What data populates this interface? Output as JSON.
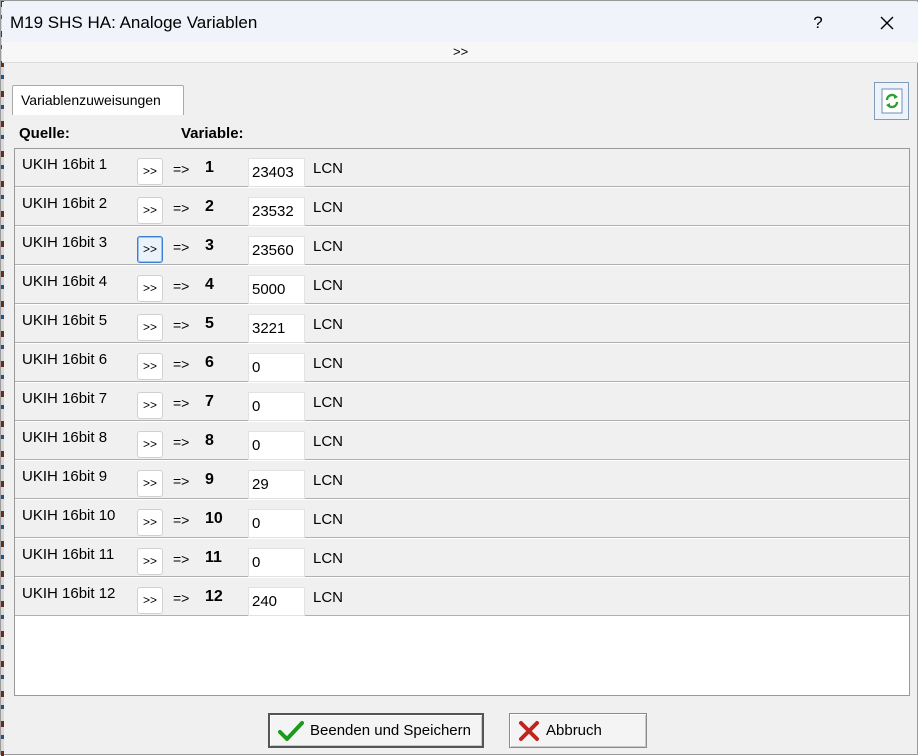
{
  "window": {
    "title": "M19 SHS HA: Analoge Variablen",
    "help_label": "?",
    "expand_label": ">>"
  },
  "tab": {
    "label": "Variablenzuweisungen"
  },
  "headers": {
    "source": "Quelle:",
    "variable": "Variable:"
  },
  "rows": [
    {
      "source": "UKIH 16bit 1",
      "button": ">>",
      "arrow": "=>",
      "number": "1",
      "value": "23403",
      "unit": "LCN"
    },
    {
      "source": "UKIH 16bit 2",
      "button": ">>",
      "arrow": "=>",
      "number": "2",
      "value": "23532",
      "unit": "LCN"
    },
    {
      "source": "UKIH 16bit 3",
      "button": ">>",
      "arrow": "=>",
      "number": "3",
      "value": "23560",
      "unit": "LCN"
    },
    {
      "source": "UKIH 16bit 4",
      "button": ">>",
      "arrow": "=>",
      "number": "4",
      "value": "5000",
      "unit": "LCN"
    },
    {
      "source": "UKIH 16bit 5",
      "button": ">>",
      "arrow": "=>",
      "number": "5",
      "value": "3221",
      "unit": "LCN"
    },
    {
      "source": "UKIH 16bit 6",
      "button": ">>",
      "arrow": "=>",
      "number": "6",
      "value": "0",
      "unit": "LCN"
    },
    {
      "source": "UKIH 16bit 7",
      "button": ">>",
      "arrow": "=>",
      "number": "7",
      "value": "0",
      "unit": "LCN"
    },
    {
      "source": "UKIH 16bit 8",
      "button": ">>",
      "arrow": "=>",
      "number": "8",
      "value": "0",
      "unit": "LCN"
    },
    {
      "source": "UKIH 16bit 9",
      "button": ">>",
      "arrow": "=>",
      "number": "9",
      "value": "29",
      "unit": "LCN"
    },
    {
      "source": "UKIH 16bit 10",
      "button": ">>",
      "arrow": "=>",
      "number": "10",
      "value": "0",
      "unit": "LCN"
    },
    {
      "source": "UKIH 16bit 11",
      "button": ">>",
      "arrow": "=>",
      "number": "11",
      "value": "0",
      "unit": "LCN"
    },
    {
      "source": "UKIH 16bit 12",
      "button": ">>",
      "arrow": "=>",
      "number": "12",
      "value": "240",
      "unit": "LCN"
    }
  ],
  "focused_row": 3,
  "buttons": {
    "save_label": "Beenden und Speichern",
    "cancel_label": "Abbruch"
  },
  "icons": {
    "save": "checkmark-icon",
    "cancel": "x-icon",
    "refresh": "refresh-icon",
    "close": "close-icon"
  },
  "colors": {
    "checkmark": "#1a9b1a",
    "cancel_x": "#c0241f",
    "refresh": "#2e9e2e"
  }
}
